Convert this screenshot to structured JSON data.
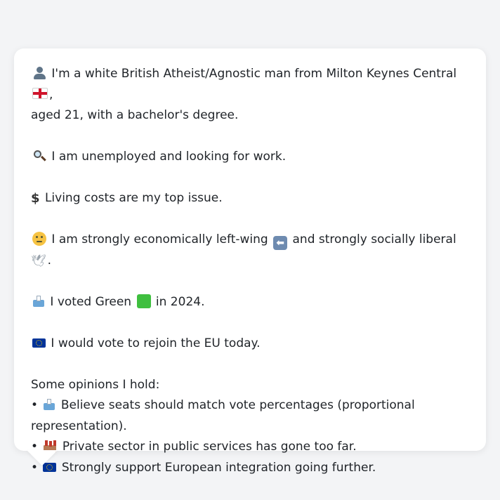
{
  "profile": {
    "intro_line1": "I'm a white British Atheist/Agnostic man from Milton Keynes Central",
    "intro_line1_end": ",",
    "intro_line2": "aged 21, with a bachelor's degree.",
    "employment": "I am unemployed and looking for work.",
    "top_issue": "Living costs are my top issue.",
    "ideology_a": "I am strongly economically left-wing",
    "ideology_b": "and strongly socially liberal",
    "ideology_end": ".",
    "vote_a": "I voted Green",
    "vote_b": "in 2024.",
    "eu": "I would vote to rejoin the EU today.",
    "opinions_heading": "Some opinions I hold:",
    "opinions": [
      "Believe seats should match vote percentages (proportional",
      "representation).",
      "Private sector in public services has gone too far.",
      "Strongly support European integration going further."
    ],
    "bullet": "•"
  },
  "icons": {
    "person": "person-silhouette-icon",
    "england_flag": "england-flag-icon",
    "magnifier": "magnifying-glass-icon",
    "dollar": "heavy-dollar-sign-icon",
    "thinking": "thinking-face-icon",
    "left_arrow": "left-arrow-icon",
    "dove": "dove-icon",
    "ballot": "ballot-box-icon",
    "green_square": "green-square-icon",
    "eu_flag": "eu-flag-icon",
    "factory": "factory-icon"
  },
  "colors": {
    "page_background": "#f3f4f6",
    "bubble_background": "#ffffff",
    "text": "#1f2328",
    "green": "#3fbf3f",
    "eu_blue": "#003399"
  }
}
